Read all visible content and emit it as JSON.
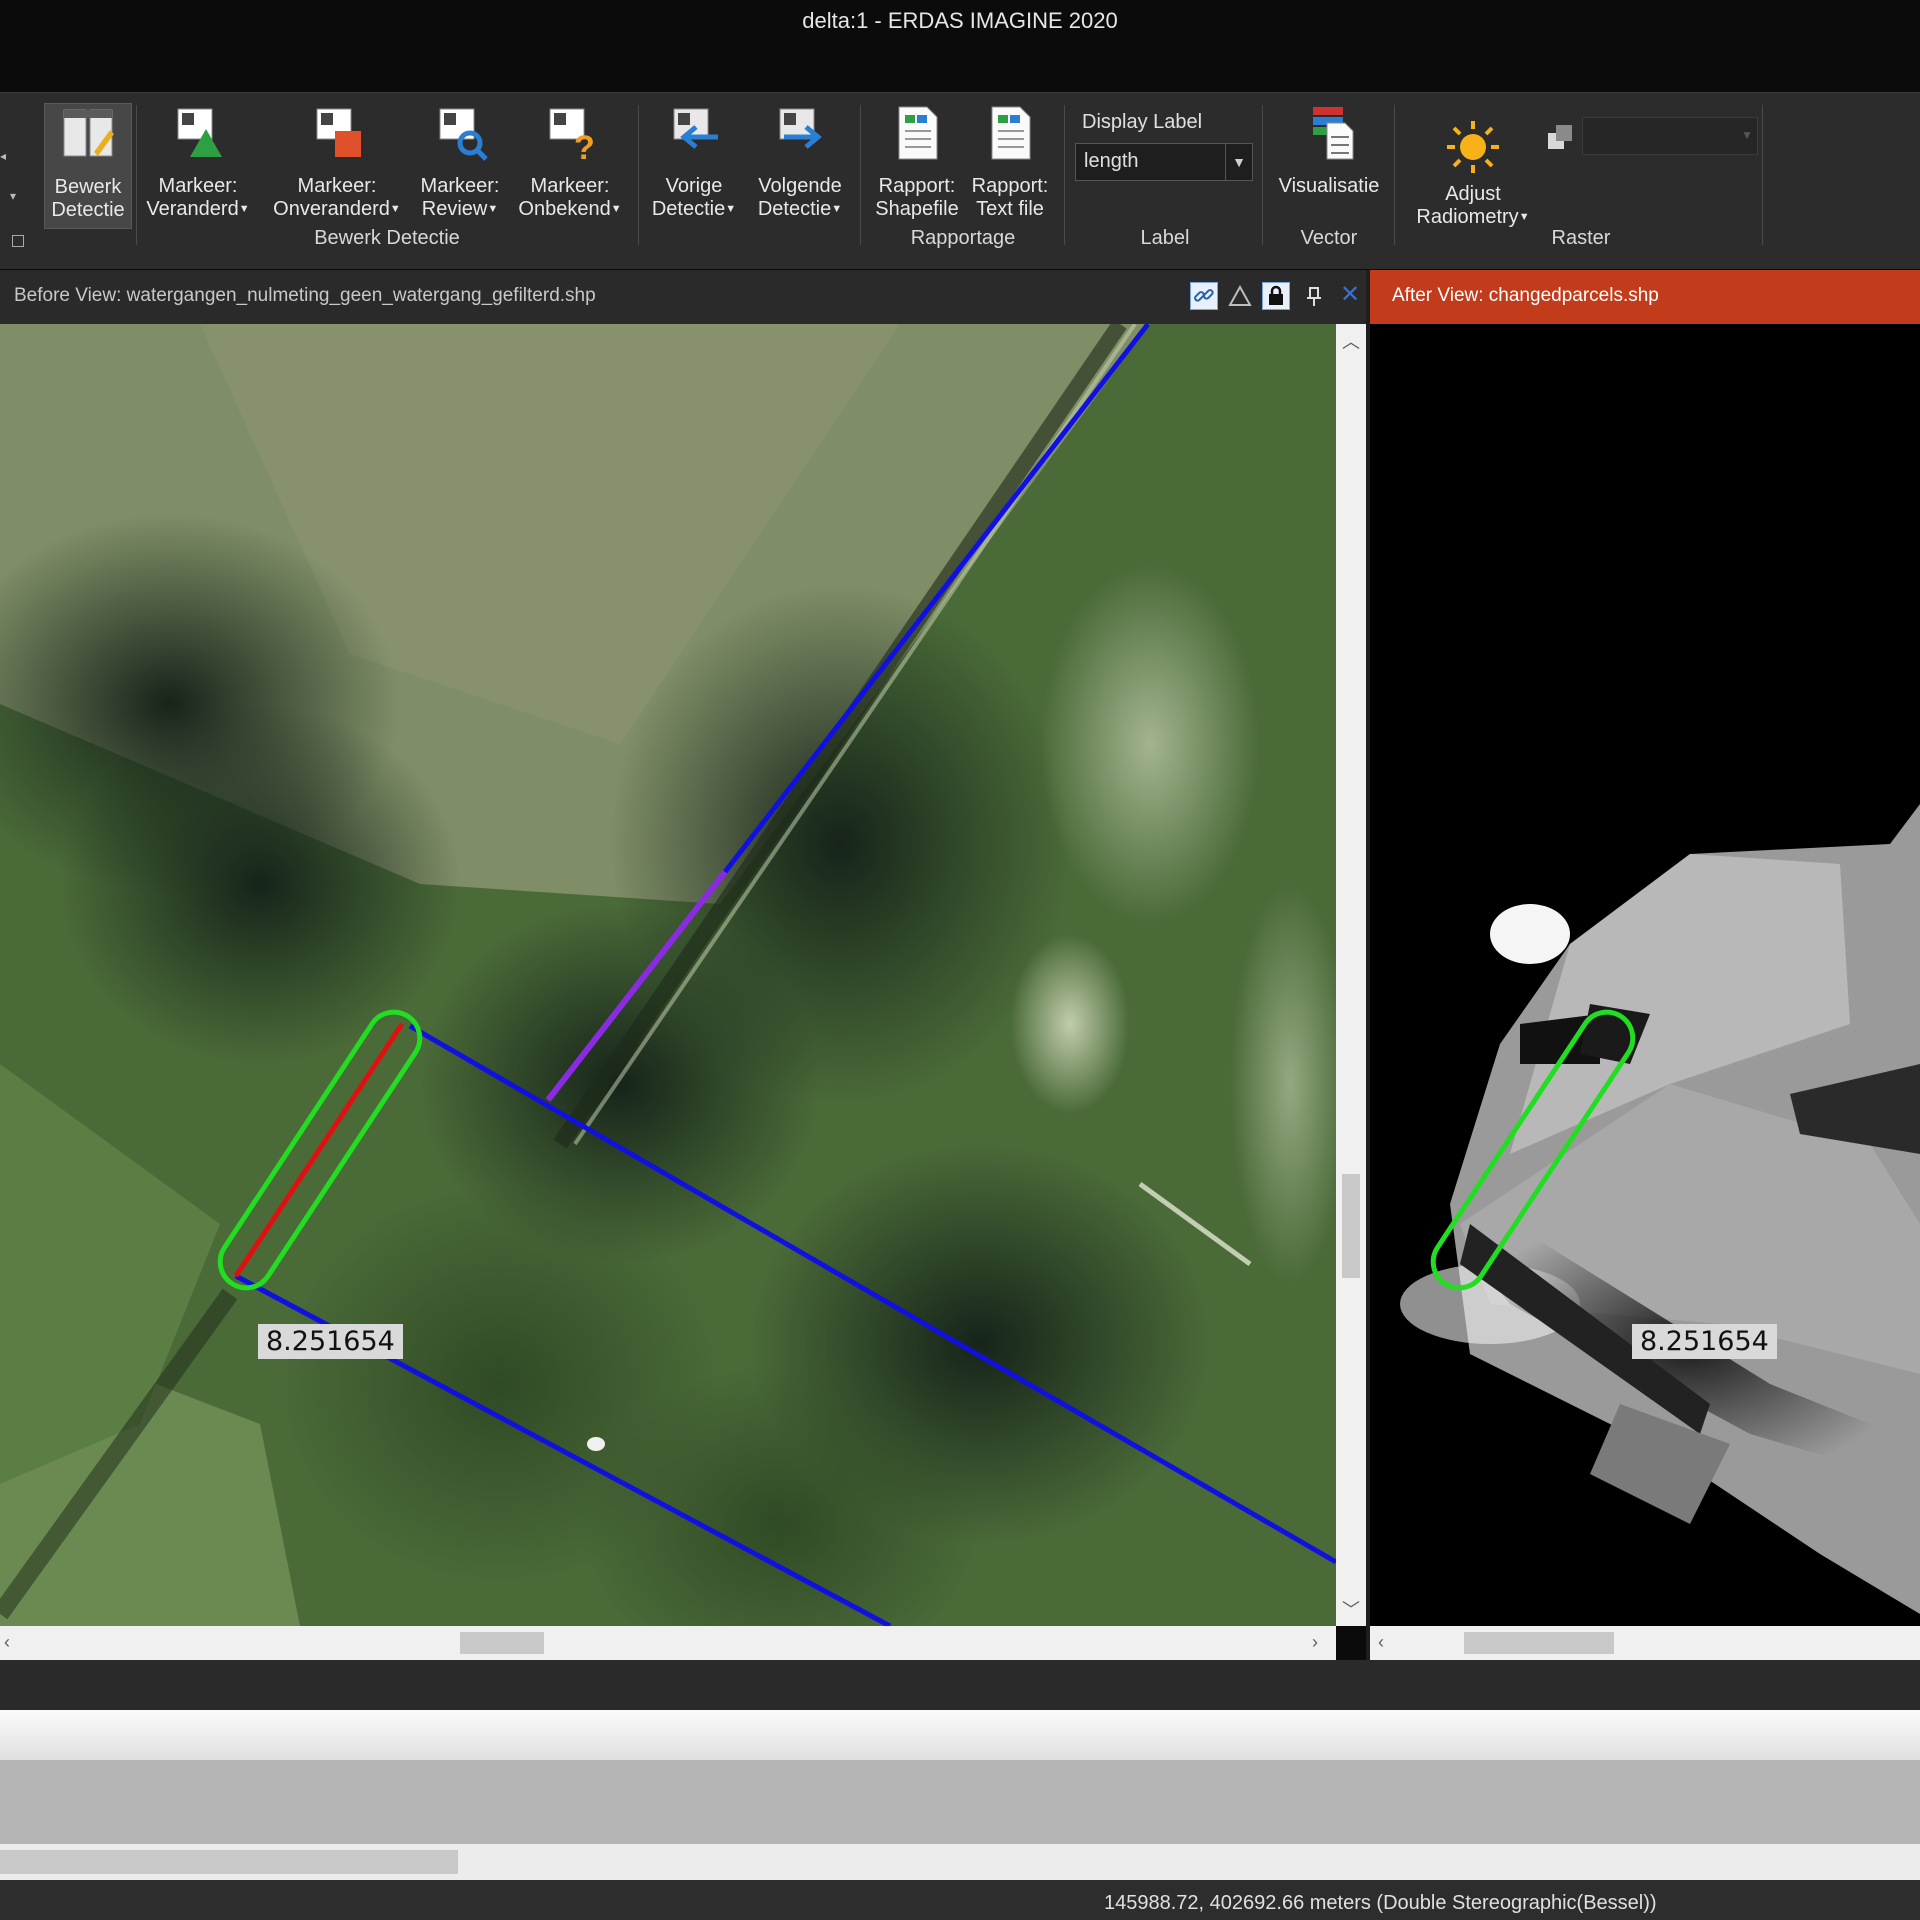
{
  "window": {
    "title": "delta:1 -  ERDAS IMAGINE 2020"
  },
  "ribbon": {
    "buttons": [
      {
        "label_1": "Bewerk",
        "label_2": "Detectie",
        "icon": "edit-detection-icon"
      },
      {
        "label_1": "Markeer:",
        "label_2": "Veranderd",
        "icon": "mark-changed-icon"
      },
      {
        "label_1": "Markeer:",
        "label_2": "Onveranderd",
        "icon": "mark-unchanged-icon"
      },
      {
        "label_1": "Markeer:",
        "label_2": "Review",
        "icon": "mark-review-icon"
      },
      {
        "label_1": "Markeer:",
        "label_2": "Onbekend",
        "icon": "mark-unknown-icon"
      },
      {
        "label_1": "Vorige",
        "label_2": "Detectie",
        "icon": "previous-detection-icon"
      },
      {
        "label_1": "Volgende",
        "label_2": "Detectie",
        "icon": "next-detection-icon"
      },
      {
        "label_1": "Rapport:",
        "label_2": "Shapefile",
        "icon": "report-shapefile-icon"
      },
      {
        "label_1": "Rapport:",
        "label_2": "Text file",
        "icon": "report-textfile-icon"
      },
      {
        "label_1": "Visualisatie",
        "label_2": "",
        "icon": "visualisation-icon"
      },
      {
        "label_1": "Adjust",
        "label_2": "Radiometry",
        "icon": "sun-icon"
      }
    ],
    "groups": {
      "bewerk_detectie": "Bewerk Detectie",
      "rapportage": "Rapportage",
      "label": "Label",
      "vector": "Vector",
      "raster": "Raster"
    },
    "display_label": {
      "caption": "Display Label",
      "value": "length"
    }
  },
  "before_view": {
    "title": "Before View: watergangen_nulmeting_geen_watergang_gefilterd.shp",
    "measure_label": "8.251654"
  },
  "after_view": {
    "title": "After View: changedparcels.shp",
    "measure_label": "8.251654"
  },
  "status": {
    "coordinates": "145988.72, 402692.66 meters (Double Stereographic(Bessel))"
  },
  "colors": {
    "accent_after_header": "#c23c1c",
    "vector_blue": "#1010e0",
    "selection_green": "#22dd22",
    "segment_red": "#e01010",
    "segment_purple": "#8a2be2"
  }
}
